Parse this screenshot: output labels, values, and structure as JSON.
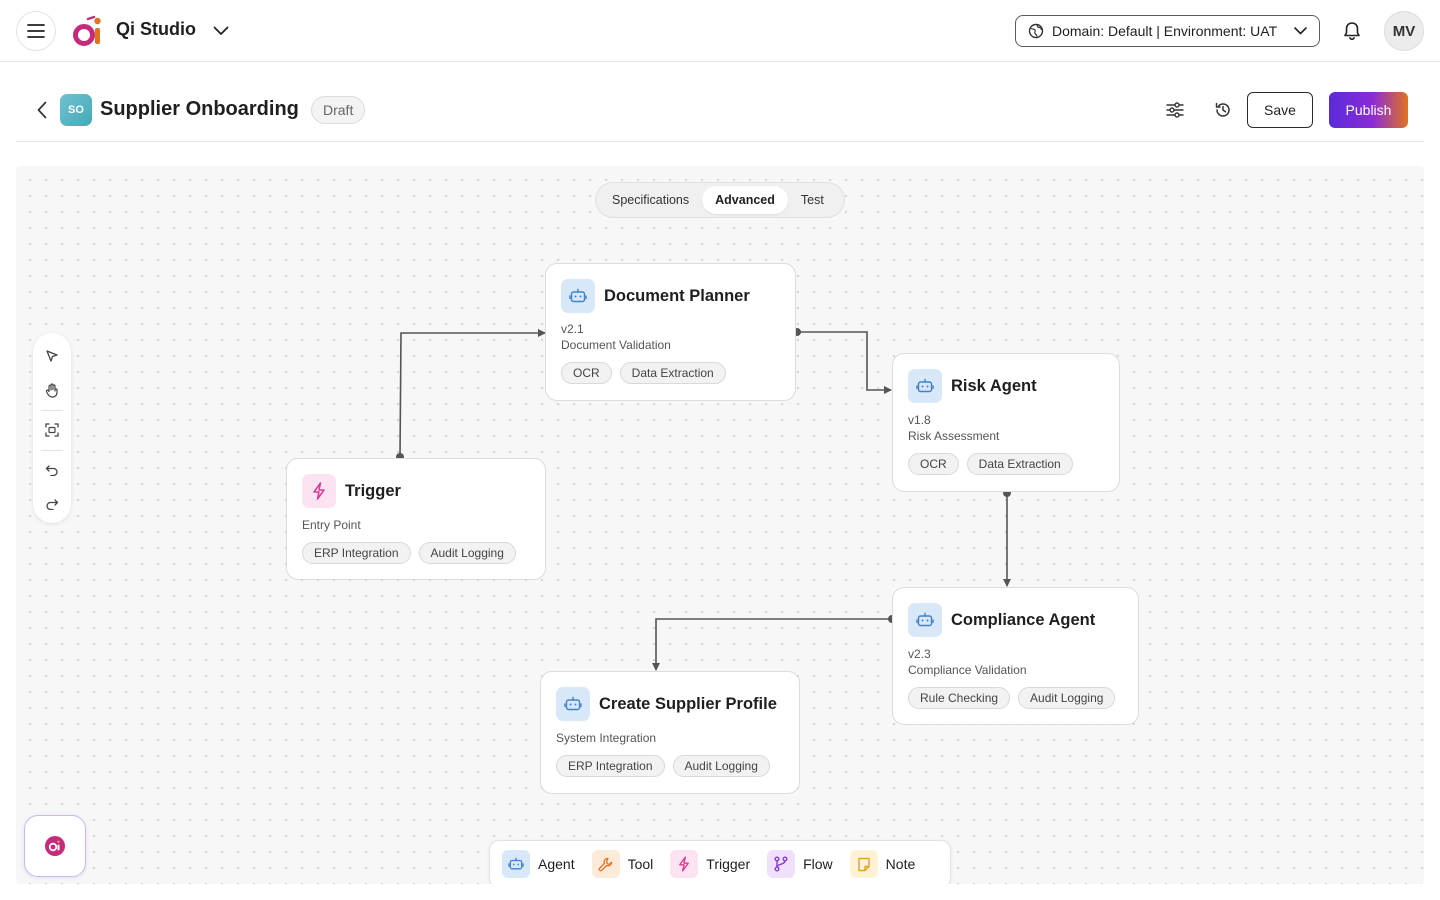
{
  "topbar": {
    "app_name": "Qi Studio",
    "environment_label": "Domain: Default | Environment: UAT",
    "user_initials": "MV"
  },
  "header": {
    "avatar_initials": "SO",
    "title": "Supplier Onboarding",
    "status_badge": "Draft",
    "save_label": "Save",
    "publish_label": "Publish"
  },
  "tabs": [
    {
      "label": "Specifications",
      "active": false
    },
    {
      "label": "Advanced",
      "active": true
    },
    {
      "label": "Test",
      "active": false
    }
  ],
  "nodes": {
    "document_planner": {
      "title": "Document Planner",
      "version": "v2.1",
      "subtitle": "Document Validation",
      "chips": [
        "OCR",
        "Data Extraction"
      ],
      "icon": "robot-icon"
    },
    "risk_agent": {
      "title": "Risk Agent",
      "version": "v1.8",
      "subtitle": "Risk Assessment",
      "chips": [
        "OCR",
        "Data Extraction"
      ],
      "icon": "robot-icon"
    },
    "trigger": {
      "title": "Trigger",
      "subtitle": "Entry Point",
      "chips": [
        "ERP Integration",
        "Audit Logging"
      ],
      "icon": "lightning-icon"
    },
    "compliance_agent": {
      "title": "Compliance Agent",
      "version": "v2.3",
      "subtitle": "Compliance Validation",
      "chips": [
        "Rule Checking",
        "Audit Logging"
      ],
      "icon": "robot-icon"
    },
    "create_supplier_profile": {
      "title": "Create Supplier Profile",
      "subtitle": "System Integration",
      "chips": [
        "ERP Integration",
        "Audit Logging"
      ],
      "icon": "robot-icon"
    }
  },
  "palette": [
    {
      "label": "Agent",
      "icon": "robot-icon"
    },
    {
      "label": "Tool",
      "icon": "wrench-icon"
    },
    {
      "label": "Trigger",
      "icon": "lightning-icon"
    },
    {
      "label": "Flow",
      "icon": "branch-icon"
    },
    {
      "label": "Note",
      "icon": "note-icon"
    }
  ],
  "colors": {
    "agent_icon_bg": "#d9e8f8",
    "agent_icon_fg": "#3f82c8",
    "trigger_icon_bg": "#fbe3f1",
    "trigger_icon_fg": "#d63b95",
    "tool_icon_fg": "#e0731f",
    "flow_icon_fg": "#8a3bd6",
    "note_icon_fg": "#e0a41f",
    "publish_gradient_start": "#5a2bd8",
    "publish_gradient_end": "#e0731f"
  }
}
